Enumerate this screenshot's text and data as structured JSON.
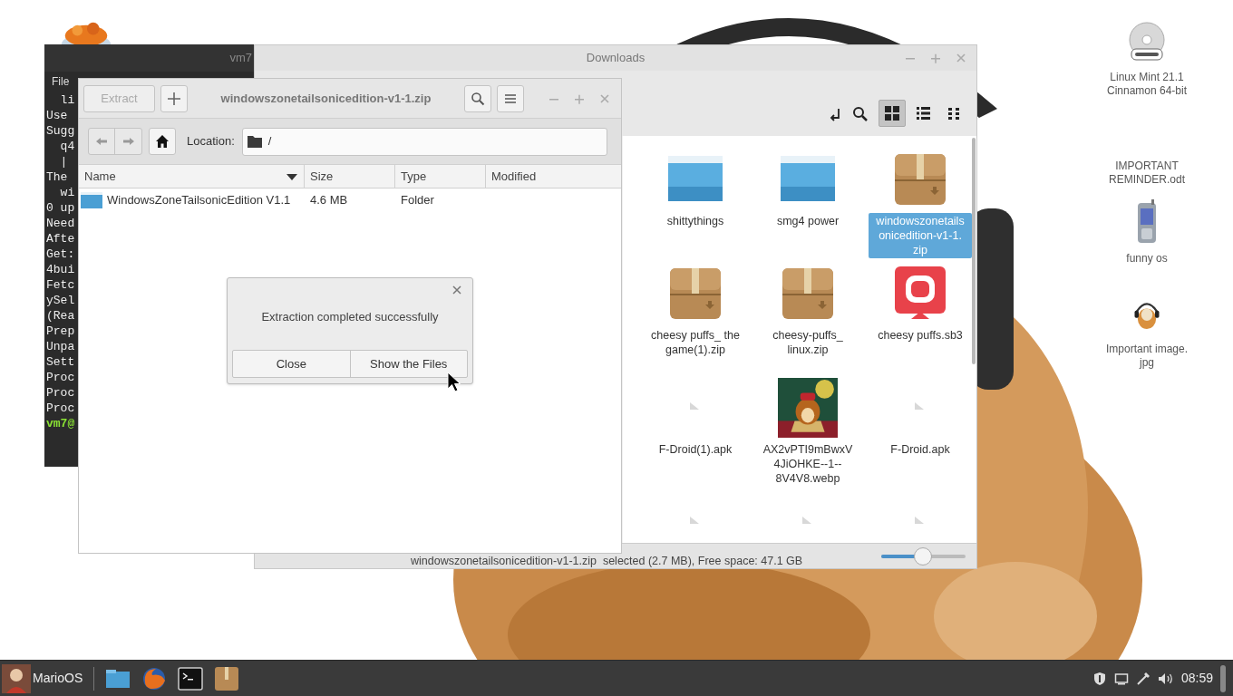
{
  "desktop_icons": [
    {
      "kind": "dvd",
      "label_lines": [
        "Linux Mint 21.1",
        "Cinnamon 64-bit"
      ]
    },
    {
      "kind": "label_only",
      "label_lines": [
        "IMPORTANT",
        "REMINDER.odt"
      ]
    },
    {
      "kind": "phone",
      "label_lines": [
        "funny os"
      ]
    },
    {
      "kind": "picture",
      "label_lines": [
        "Important image.",
        "jpg"
      ]
    }
  ],
  "terminal": {
    "title": "vm7",
    "menu": [
      "File"
    ],
    "lines": [
      {
        "kind": "output",
        "text": "  li"
      },
      {
        "kind": "output",
        "text": "Use"
      },
      {
        "kind": "output",
        "text": "Sugg"
      },
      {
        "kind": "output",
        "text": "  q4"
      },
      {
        "kind": "output",
        "text": "  |"
      },
      {
        "kind": "output",
        "text": "The"
      },
      {
        "kind": "output",
        "text": "  wi"
      },
      {
        "kind": "output",
        "text": "0 up"
      },
      {
        "kind": "output",
        "text": "Need"
      },
      {
        "kind": "output",
        "text": "Afte"
      },
      {
        "kind": "output",
        "text": "Get:"
      },
      {
        "kind": "output",
        "text": "4bui"
      },
      {
        "kind": "output",
        "text": "Fetc"
      },
      {
        "kind": "output",
        "text": "ySel"
      },
      {
        "kind": "output",
        "text": "(Rea"
      },
      {
        "kind": "output",
        "text": "Prep"
      },
      {
        "kind": "output",
        "text": "Unpa"
      },
      {
        "kind": "output",
        "text": "Sett"
      },
      {
        "kind": "output",
        "text": "Proc"
      },
      {
        "kind": "output",
        "text": "Proc"
      },
      {
        "kind": "output",
        "text": "Proc"
      },
      {
        "kind": "prompt",
        "text": "vm7@"
      }
    ]
  },
  "file_manager": {
    "title": "Downloads",
    "view_buttons": [
      {
        "kind": "grid",
        "selected": true
      },
      {
        "kind": "list",
        "selected": false
      },
      {
        "kind": "compact",
        "selected": false
      }
    ],
    "items": [
      {
        "kind": "folder",
        "selected": false,
        "label_lines": [
          "shittythings"
        ]
      },
      {
        "kind": "folder",
        "selected": false,
        "label_lines": [
          "smg4 power"
        ]
      },
      {
        "kind": "archive",
        "selected": true,
        "label_lines": [
          "windowszonetails",
          "onicedition-v1-1.",
          "zip"
        ]
      },
      {
        "kind": "archive",
        "selected": false,
        "label_lines": [
          "cheesy puffs_ the",
          "game(1).zip"
        ]
      },
      {
        "kind": "archive",
        "selected": false,
        "label_lines": [
          "cheesy-puffs_",
          "linux.zip"
        ]
      },
      {
        "kind": "app",
        "selected": false,
        "label_lines": [
          "cheesy puffs.sb3"
        ]
      },
      {
        "kind": "generic",
        "selected": false,
        "label_lines": [
          "F-Droid(1).apk"
        ]
      },
      {
        "kind": "picture",
        "selected": false,
        "label_lines": [
          "AX2vPTI9mBwxV",
          "4JiOHKE--1--",
          "8V4V8.webp"
        ]
      },
      {
        "kind": "generic",
        "selected": false,
        "label_lines": [
          "F-Droid.apk"
        ]
      },
      {
        "kind": "generic",
        "selected": false
      },
      {
        "kind": "generic",
        "selected": false
      },
      {
        "kind": "generic",
        "selected": false
      }
    ],
    "status": "windowszonetailsonicedition-v1-1.zip  selected (2.7 MB), Free space: 47.1 GB",
    "zoom": {
      "level": 0.49
    }
  },
  "archive_manager": {
    "extract_button": {
      "label": "Extract",
      "disabled": true
    },
    "title": "windowszonetailsonicedition-v1-1.zip",
    "location_label": "Location:",
    "location": "/",
    "columns": [
      {
        "label": "Name",
        "sorted": true
      },
      {
        "label": "Size",
        "sorted": false
      },
      {
        "label": "Type",
        "sorted": false
      },
      {
        "label": "Modified",
        "sorted": false
      }
    ],
    "rows": [
      {
        "kind": "folder",
        "name": "WindowsZoneTailsonicEdition V1.1",
        "size": "4.6 MB",
        "type": "Folder"
      }
    ]
  },
  "dialog": {
    "message": "Extraction completed successfully",
    "buttons": [
      "Close",
      "Show the Files"
    ]
  },
  "taskbar": {
    "menu_label": "MarioOS",
    "launchers": [
      {
        "kind": "folder"
      },
      {
        "kind": "browser"
      },
      {
        "kind": "terminal"
      },
      {
        "kind": "archive"
      }
    ],
    "clock": "08:59"
  }
}
